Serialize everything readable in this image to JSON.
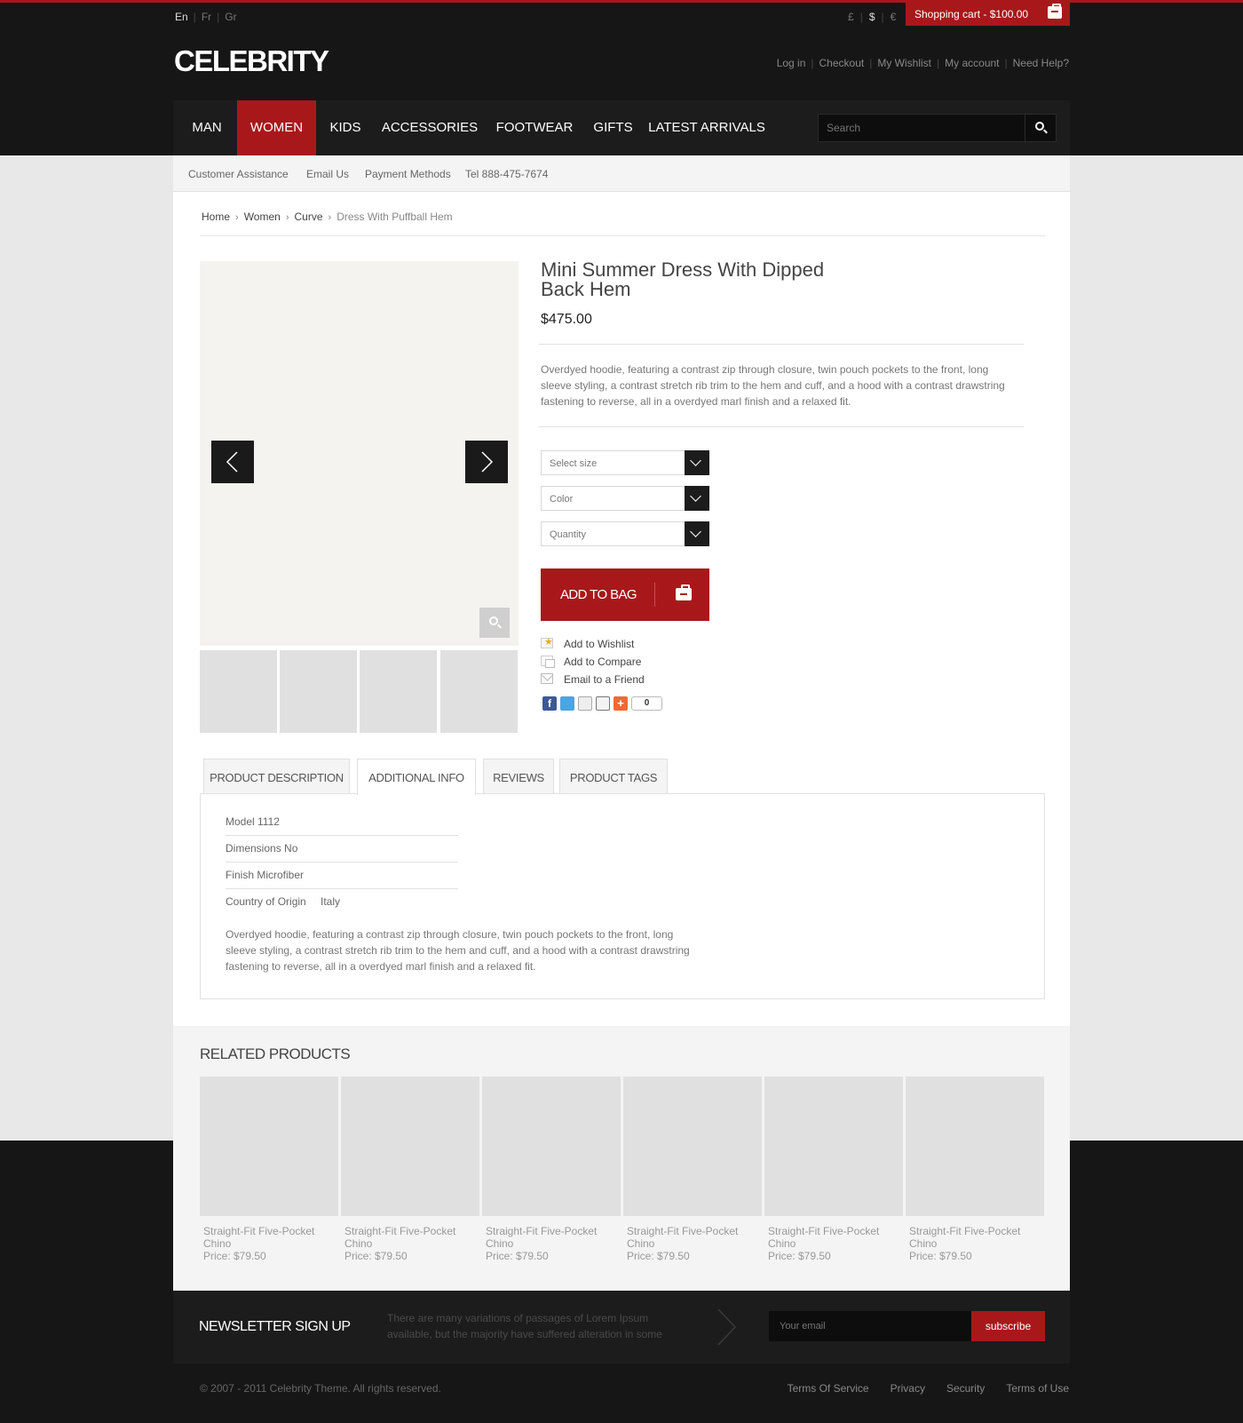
{
  "topbar": {
    "languages": [
      "En",
      "Fr",
      "Gr"
    ],
    "currencies": [
      "£",
      "$",
      "€"
    ],
    "cart_label": "Shopping cart - $100.00"
  },
  "header": {
    "logo": "CELEBRITY",
    "user_links": [
      "Log in",
      "Checkout",
      "My Wishlist",
      "My account",
      "Need Help?"
    ]
  },
  "nav": {
    "items": [
      "MAN",
      "WOMEN",
      "KIDS",
      "ACCESSORIES",
      "FOOTWEAR",
      "GIFTS",
      "LATEST ARRIVALS"
    ],
    "active": "WOMEN",
    "search_placeholder": "Search"
  },
  "subnav": [
    "Customer Assistance",
    "Email Us",
    "Payment Methods",
    "Tel 888-475-7674"
  ],
  "breadcrumb": [
    "Home",
    "Women",
    "Curve",
    "Dress With Puffball Hem"
  ],
  "product": {
    "title": "Mini Summer Dress With Dipped Back Hem",
    "price": "$475.00",
    "description": "Overdyed hoodie, featuring a contrast zip through closure, twin pouch pockets to the front, long sleeve styling, a contrast stretch rib trim to the hem and cuff, and a hood with a contrast drawstring fastening to reverse, all in a overdyed marl finish and a relaxed fit.",
    "selects": [
      "Select size",
      "Color",
      "Quantity"
    ],
    "add_to_bag": "ADD TO BAG",
    "actions": [
      "Add to Wishlist",
      "Add to Compare",
      "Email to a Friend"
    ],
    "share_count": "0"
  },
  "tabs": {
    "labels": [
      "PRODUCT DESCRIPTION",
      "ADDITIONAL INFO",
      "REVIEWS",
      "PRODUCT TAGS"
    ],
    "active": "ADDITIONAL INFO",
    "info_rows": [
      {
        "label": "Model 1112",
        "value": ""
      },
      {
        "label": "Dimensions No",
        "value": ""
      },
      {
        "label": "Finish Microfiber",
        "value": ""
      },
      {
        "label": "Country of Origin",
        "value": "Italy"
      }
    ],
    "panel_text": "Overdyed hoodie, featuring a contrast zip through closure, twin pouch pockets to the front, long sleeve styling, a contrast stretch rib trim to the hem and cuff, and a hood with a contrast drawstring fastening to reverse, all in a overdyed marl finish and a relaxed fit."
  },
  "related": {
    "title": "RELATED PRODUCTS",
    "items": [
      {
        "name": "Straight-Fit Five-Pocket Chino",
        "price": "Price: $79.50"
      },
      {
        "name": "Straight-Fit Five-Pocket Chino",
        "price": "Price: $79.50"
      },
      {
        "name": "Straight-Fit Five-Pocket Chino",
        "price": "Price: $79.50"
      },
      {
        "name": "Straight-Fit Five-Pocket Chino",
        "price": "Price: $79.50"
      },
      {
        "name": "Straight-Fit Five-Pocket Chino",
        "price": "Price: $79.50"
      },
      {
        "name": "Straight-Fit Five-Pocket Chino",
        "price": "Price: $79.50"
      }
    ]
  },
  "newsletter": {
    "title": "NEWSLETTER SIGN UP",
    "text": "There are many variations of passages of Lorem Ipsum available, but the majority have suffered alteration in some",
    "placeholder": "Your email",
    "button": "subscribe"
  },
  "footer": {
    "copyright": "© 2007 - 2011 Celebrity Theme. All rights reserved.",
    "links": [
      "Terms Of Service",
      "Privacy",
      "Security",
      "Terms of Use"
    ]
  },
  "colors": {
    "accent": "#a8181b",
    "dark": "#161616"
  }
}
